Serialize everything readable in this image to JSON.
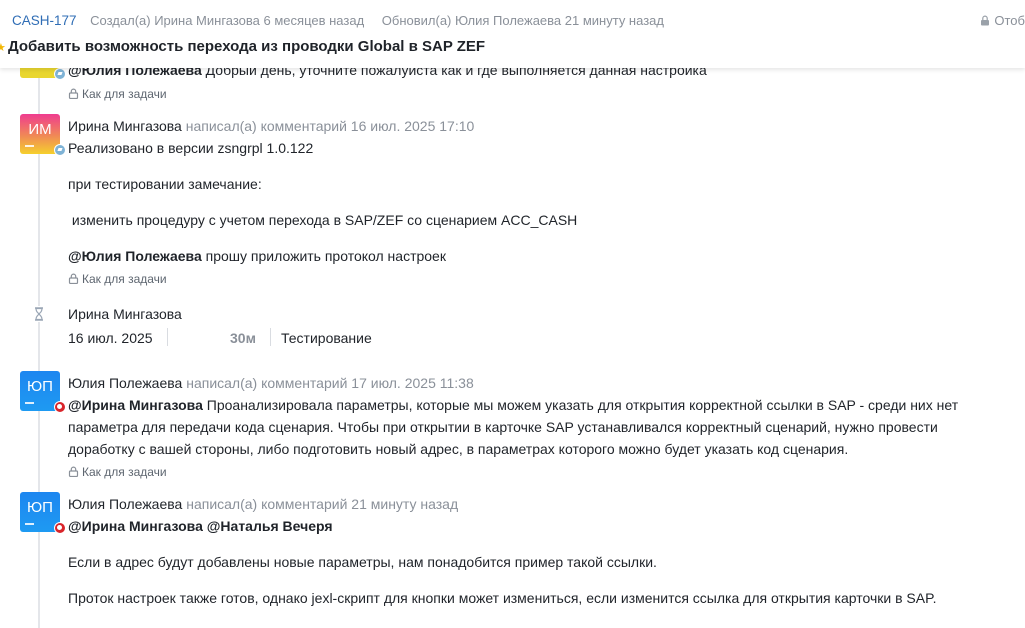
{
  "header": {
    "issue_key": "CASH-177",
    "created": "Создал(а) Ирина Мингазова 6 месяцев назад",
    "updated": "Обновил(а) Юлия Полежаева 21 минуту назад",
    "privacy": "Отоб",
    "title": "Добавить возможность перехода из проводки Global в SAP ZEF"
  },
  "visibility_label": "Как для задачи",
  "comment0": {
    "mention": "@Юлия Полежаева",
    "text": " Добрый день, уточните пожалуйста как и где выполняется данная настройка"
  },
  "comment1": {
    "initials": "ИМ",
    "author": "Ирина Мингазова",
    "action": " написал(а) комментарий 16 июл. 2025 17:10",
    "p1": "Реализовано в версии zsngrpl 1.0.122",
    "p2": "при тестировании замечание:",
    "p3": " изменить процедуру с учетом перехода в SAP/ZEF со сценарием ACC_CASH",
    "p4_mention": "@Юлия Полежаева",
    "p4_text": " прошу приложить протокол настроек"
  },
  "worklog": {
    "author": "Ирина Мингазова",
    "date": "16 июл. 2025",
    "duration": "30м",
    "status": "Тестирование"
  },
  "comment2": {
    "initials": "ЮП",
    "author": "Юлия Полежаева",
    "action": " написал(а) комментарий 17 июл. 2025 11:38",
    "mention": "@Ирина Мингазова",
    "l1": " Проанализировала параметры, которые мы можем указать для открытия корректной ссылки в SAP - среди них нет",
    "l2": "параметра для передачи кода сценария. Чтобы при открытии в карточке SAP устанавливался корректный сценарий, нужно провести",
    "l3": "доработку с вашей стороны, либо подготовить новый адрес, в параметрах которого можно будет указать код сценария."
  },
  "comment3": {
    "initials": "ЮП",
    "author": "Юлия Полежаева",
    "action": " написал(а) комментарий 21 минуту назад",
    "mentions": "@Ирина Мингазова @Наталья Вечеря",
    "p1": "Если в адрес будут добавлены новые параметры, нам понадобится пример такой ссылки.",
    "p2": "Проток настроек также готов, однако jexl-скрипт для кнопки может измениться, если изменится ссылка для открытия карточки в SAP."
  },
  "colors": {
    "link": "#2f6db5",
    "muted": "#8a9099",
    "star": "#f2b705",
    "avatar_blue": "#1d86f0",
    "badge_red": "#d9242a"
  },
  "icons": [
    "lock-icon",
    "star-icon",
    "hourglass-icon",
    "telegram-badge-icon",
    "red-badge-icon"
  ]
}
